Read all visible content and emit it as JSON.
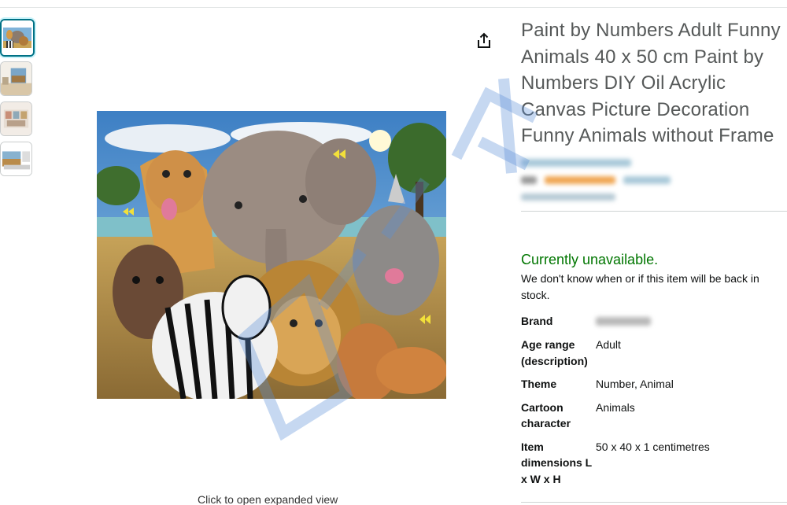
{
  "product": {
    "title": "Paint by Numbers Adult Funny Animals 40 x 50 cm Paint by Numbers DIY Oil Acrylic Canvas Picture Decoration Funny Animals without Frame"
  },
  "gallery": {
    "expand_hint": "Click to open expanded view",
    "thumbnail_count": 4,
    "selected_index": 0
  },
  "availability": {
    "status": "Currently unavailable.",
    "note": "We don't know when or if this item will be back in stock."
  },
  "specs": [
    {
      "key": "Brand",
      "value": ""
    },
    {
      "key": "Age range (description)",
      "value": "Adult"
    },
    {
      "key": "Theme",
      "value": "Number, Animal"
    },
    {
      "key": "Cartoon character",
      "value": "Animals"
    },
    {
      "key": "Item dimensions L x W x H",
      "value": "50 x 40 x 1 centimetres"
    }
  ],
  "icons": {
    "share": "share-icon"
  },
  "colors": {
    "availability_green": "#007600",
    "selected_thumb_border": "#007185",
    "title_grey": "#565959"
  }
}
